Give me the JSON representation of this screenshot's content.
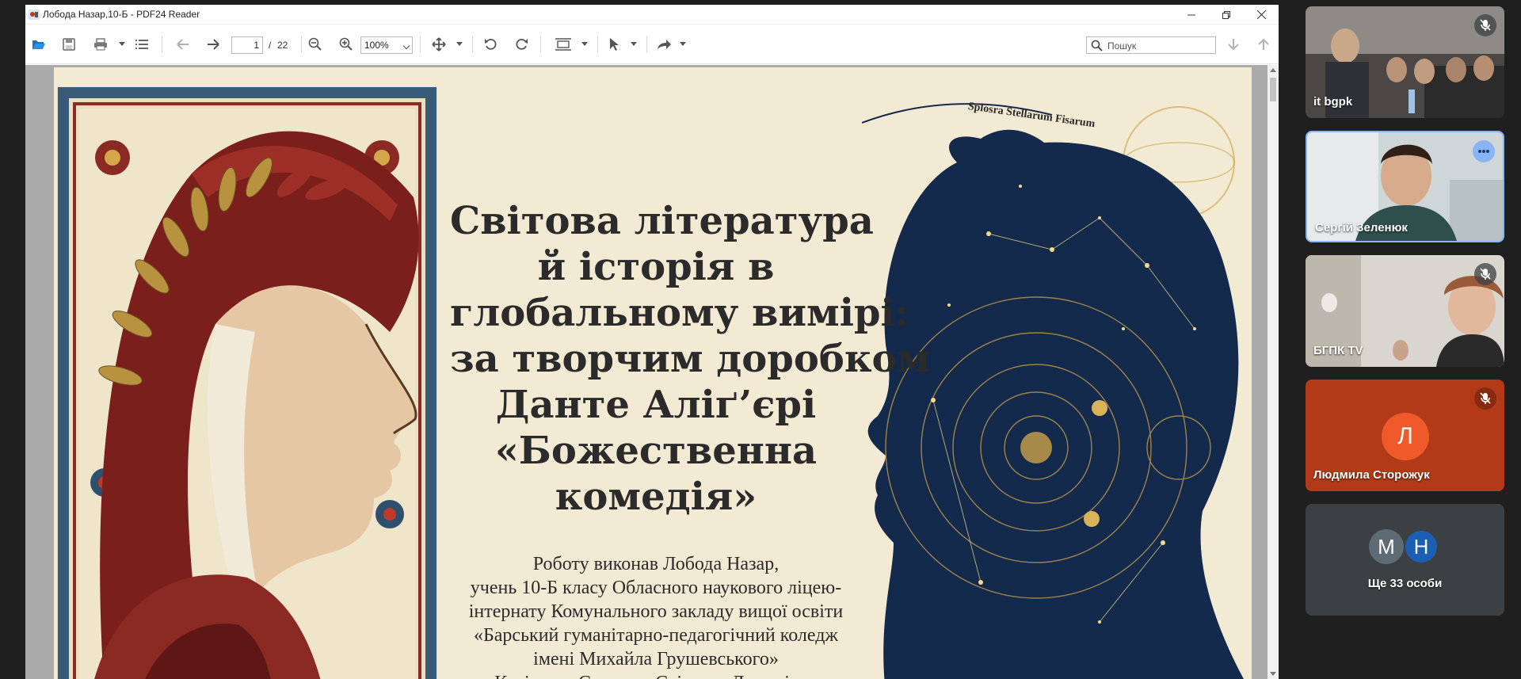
{
  "reader": {
    "window_title": "Лобода Назар,10-Б - PDF24 Reader",
    "page_current": "1",
    "page_separator": "/",
    "page_total": "22",
    "zoom": "100%",
    "search_placeholder": "Пошук",
    "accent_color": "#1e73be"
  },
  "slide": {
    "constellation_label": "Splosra Stellarum Fisarum",
    "title_lines": [
      "Світова література",
      "й історія в",
      "глобальному вимірі:",
      "за творчим доробком",
      "Данте Аліґ’єрі",
      "«Божественна",
      "комедія»"
    ],
    "body_lines": [
      "Роботу виконав Лобода Назар,",
      "учень 10-Б класу Обласного наукового ліцею-",
      "інтернату Комунального закладу вищої освіти",
      "«Барський гуманітарно-педагогічний коледж",
      "імені Михайла Грушевського»",
      "Керівник: Середюк Світлана Дмитрівна"
    ]
  },
  "participants": {
    "tiles": [
      {
        "name": "it bgpk",
        "muted": true,
        "kind": "video"
      },
      {
        "name": "Сергій Зеленюк",
        "muted": false,
        "kind": "video",
        "speaking": true
      },
      {
        "name": "БГПК TV",
        "muted": true,
        "kind": "video"
      },
      {
        "name": "Людмила Сторожук",
        "muted": true,
        "kind": "avatar",
        "initial": "Л",
        "bg_color": "#b33a18",
        "avatar_color": "#ef5a2a"
      }
    ],
    "more": {
      "label": "Ще 33 особи",
      "initials": [
        "М",
        "Н"
      ],
      "avatar_colors": [
        "#5f6b74",
        "#1a5fb4"
      ]
    },
    "active_speaker_color": "#8ab4f8"
  }
}
